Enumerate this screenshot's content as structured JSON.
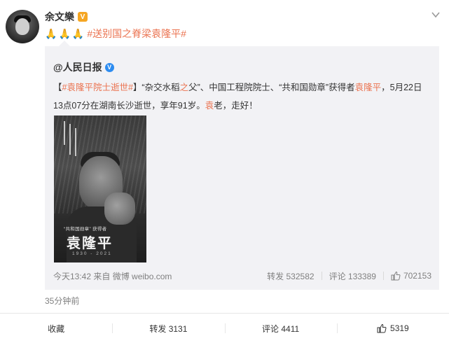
{
  "post": {
    "author": "余文樂",
    "badge_icon": "vip-badge",
    "emojis": [
      "🙏",
      "🙏",
      "🙏"
    ],
    "hashtag": "#送别国之脊梁袁隆平#"
  },
  "repost": {
    "author": "@人民日报",
    "verified_icon": "blue-v-icon",
    "text_part1": "【",
    "tag": "#袁隆平院士逝世#",
    "text_part2": "】“杂交水稻",
    "red_zhi": "之",
    "text_part3": "父”、中国工程院院士、“共和国勋章”获得者",
    "red_name": "袁隆平",
    "text_part4": "，5月22日13点07分在湖南长沙逝世，享年91岁。",
    "red_yuan": "袁",
    "text_part5": "老，走好！",
    "image": {
      "caption_small": "“共和国勋章” 获得者",
      "caption_big": "袁隆平",
      "caption_years": "1930 - 2021"
    },
    "footer": {
      "time": "今天13:42 来自 微博 weibo.com",
      "repost_label": "转发 532582",
      "comment_label": "评论 133389",
      "like_count": "702153"
    }
  },
  "posted_ago": "35分钟前",
  "actions": {
    "favorite": "收藏",
    "repost": "转发 3131",
    "comment": "评论 4411",
    "like": "5319"
  },
  "colors": {
    "accent": "#eb7350",
    "background": "#ffffff",
    "repost_bg": "#f2f2f5",
    "muted_text": "#808080"
  }
}
